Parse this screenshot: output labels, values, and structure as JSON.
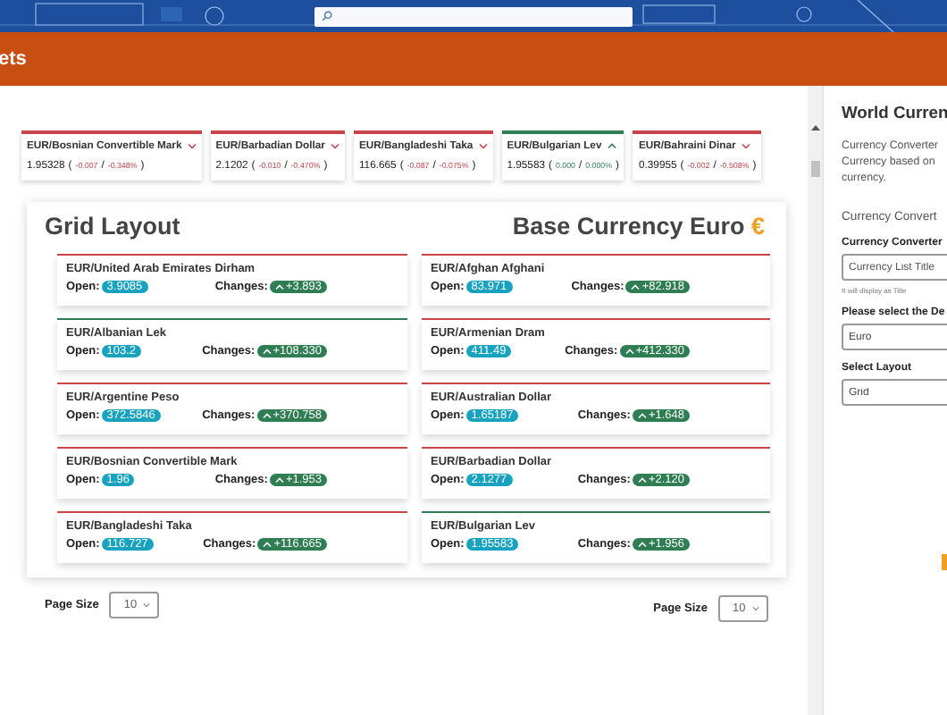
{
  "nav": {
    "label": "ets"
  },
  "ticker": [
    {
      "pair": "EUR/Bosnian Convertible Mark",
      "rising": false,
      "color": "#c8434a",
      "rate": "1.95328",
      "open_paren": "(",
      "change": "-0.007",
      "separator": "/",
      "percent": "-0.348%",
      "close_paren": ")"
    },
    {
      "pair": "EUR/Barbadian Dollar",
      "rising": false,
      "color": "#c8434a",
      "rate": "2.1202",
      "open_paren": "(",
      "change": "-0.010",
      "separator": "/",
      "percent": "-0.470%",
      "close_paren": ")"
    },
    {
      "pair": "EUR/Bangladeshi Taka",
      "rising": false,
      "color": "#c8434a",
      "rate": "116.665",
      "open_paren": "(",
      "change": "-0.087",
      "separator": "/",
      "percent": "-0.075%",
      "close_paren": ")"
    },
    {
      "pair": "EUR/Bulgarian Lev",
      "rising": true,
      "color": "#2f7d55",
      "rate": "1.95583",
      "open_paren": "(",
      "change": "0.000",
      "separator": "/",
      "percent": "0.000%",
      "close_paren": ")"
    },
    {
      "pair": "EUR/Bahraini Dinar",
      "rising": false,
      "color": "#c8434a",
      "rate": "0.39955",
      "open_paren": "(",
      "change": "-0.002",
      "separator": "/",
      "percent": "-0.508%",
      "close_paren": ")"
    }
  ],
  "grid": {
    "title": "Grid Layout",
    "base_label": "Base Currency Euro",
    "base_symbol": "€",
    "items": [
      {
        "pair": "EUR/United Arab Emirates Dirham",
        "color": "#c8434a",
        "open_label": "Open:",
        "open": "3.9085",
        "changes_label": "Changes:",
        "change": "+3.893"
      },
      {
        "pair": "EUR/Afghan Afghani",
        "color": "#c8434a",
        "open_label": "Open:",
        "open": "83.971",
        "changes_label": "Changes:",
        "change": "+82.918"
      },
      {
        "pair": "EUR/Albanian Lek",
        "color": "#2f7d55",
        "open_label": "Open:",
        "open": "103.2",
        "changes_label": "Changes:",
        "change": "+108.330"
      },
      {
        "pair": "EUR/Armenian Dram",
        "color": "#c8434a",
        "open_label": "Open:",
        "open": "411.49",
        "changes_label": "Changes:",
        "change": "+412.330"
      },
      {
        "pair": "EUR/Argentine Peso",
        "color": "#c8434a",
        "open_label": "Open:",
        "open": "372.5846",
        "changes_label": "Changes:",
        "change": "+370.758"
      },
      {
        "pair": "EUR/Australian Dollar",
        "color": "#c8434a",
        "open_label": "Open:",
        "open": "1.65187",
        "changes_label": "Changes:",
        "change": "+1.648"
      },
      {
        "pair": "EUR/Bosnian Convertible Mark",
        "color": "#c8434a",
        "open_label": "Open:",
        "open": "1.96",
        "changes_label": "Changes:",
        "change": "+1.953"
      },
      {
        "pair": "EUR/Barbadian Dollar",
        "color": "#c8434a",
        "open_label": "Open:",
        "open": "2.1277",
        "changes_label": "Changes:",
        "change": "+2.120"
      },
      {
        "pair": "EUR/Bangladeshi Taka",
        "color": "#c8434a",
        "open_label": "Open:",
        "open": "116.727",
        "changes_label": "Changes:",
        "change": "+116.665"
      },
      {
        "pair": "EUR/Bulgarian Lev",
        "color": "#2f7d55",
        "open_label": "Open:",
        "open": "1.95583",
        "changes_label": "Changes:",
        "change": "+1.956"
      }
    ]
  },
  "pagers": [
    {
      "label": "Page Size",
      "value": "10"
    },
    {
      "label": "Page Size",
      "value": "10"
    }
  ],
  "panel": {
    "title": "World Curren",
    "description": [
      "Currency Converter",
      "Currency based on",
      "currency."
    ],
    "section": "Currency Convert",
    "fields": [
      {
        "label": "Currency Converter",
        "placeholder": "Currency List Title",
        "hint": "It will display as Title"
      },
      {
        "label": "Please select the De",
        "value": "Euro"
      },
      {
        "label": "Select Layout",
        "value": "Grid"
      }
    ]
  }
}
